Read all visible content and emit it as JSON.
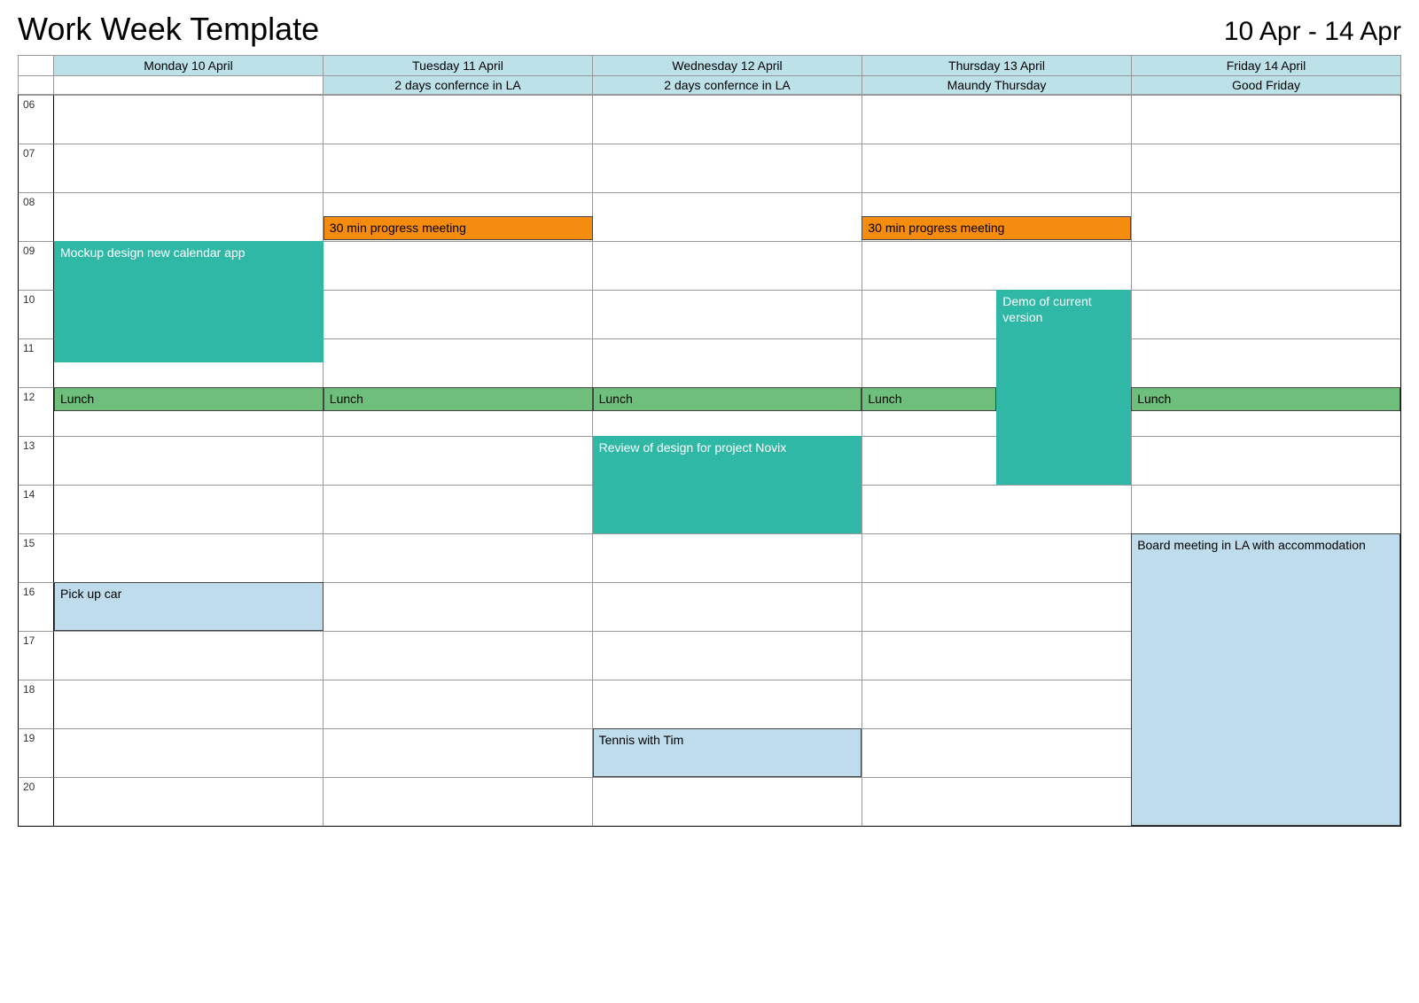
{
  "header": {
    "title": "Work Week Template",
    "date_range": "10 Apr - 14 Apr"
  },
  "days": [
    {
      "label": "Monday 10 April",
      "allday": ""
    },
    {
      "label": "Tuesday 11 April",
      "allday": "2 days confernce in LA"
    },
    {
      "label": "Wednesday 12 April",
      "allday": "2 days confernce in LA"
    },
    {
      "label": "Thursday 13 April",
      "allday": "Maundy Thursday"
    },
    {
      "label": "Friday 14 April",
      "allday": "Good Friday"
    }
  ],
  "hours": [
    "06",
    "07",
    "08",
    "09",
    "10",
    "11",
    "12",
    "13",
    "14",
    "15",
    "16",
    "17",
    "18",
    "19",
    "20"
  ],
  "events": {
    "mon_mockup": {
      "title": "Mockup design new calendar app",
      "day": 0,
      "start": "09:00",
      "end": "11:30",
      "color": "teal"
    },
    "mon_lunch": {
      "title": "Lunch",
      "day": 0,
      "start": "12:00",
      "end": "12:30",
      "color": "green"
    },
    "mon_pickup": {
      "title": "Pick up car",
      "day": 0,
      "start": "16:00",
      "end": "17:00",
      "color": "blue"
    },
    "tue_progress": {
      "title": "30 min progress meeting",
      "day": 1,
      "start": "08:30",
      "end": "09:00",
      "color": "orange"
    },
    "tue_lunch": {
      "title": "Lunch",
      "day": 1,
      "start": "12:00",
      "end": "12:30",
      "color": "green"
    },
    "wed_lunch": {
      "title": "Lunch",
      "day": 2,
      "start": "12:00",
      "end": "12:30",
      "color": "green"
    },
    "wed_review": {
      "title": "Review of design for project Novix",
      "day": 2,
      "start": "13:00",
      "end": "15:00",
      "color": "teal"
    },
    "wed_tennis": {
      "title": "Tennis with Tim",
      "day": 2,
      "start": "19:00",
      "end": "20:00",
      "color": "blue"
    },
    "thu_progress": {
      "title": "30 min progress meeting",
      "day": 3,
      "start": "08:30",
      "end": "09:00",
      "color": "orange"
    },
    "thu_lunch": {
      "title": "Lunch",
      "day": 3,
      "start": "12:00",
      "end": "12:30",
      "color": "green"
    },
    "thu_demo": {
      "title": "Demo of current version",
      "day": 3,
      "start": "10:00",
      "end": "14:00",
      "color": "teal",
      "half_width": true
    },
    "fri_lunch": {
      "title": "Lunch",
      "day": 4,
      "start": "12:00",
      "end": "12:30",
      "color": "green"
    },
    "fri_board": {
      "title": "Board meeting in LA with accommodation",
      "day": 4,
      "start": "15:00",
      "end": "21:00",
      "color": "blue"
    }
  }
}
